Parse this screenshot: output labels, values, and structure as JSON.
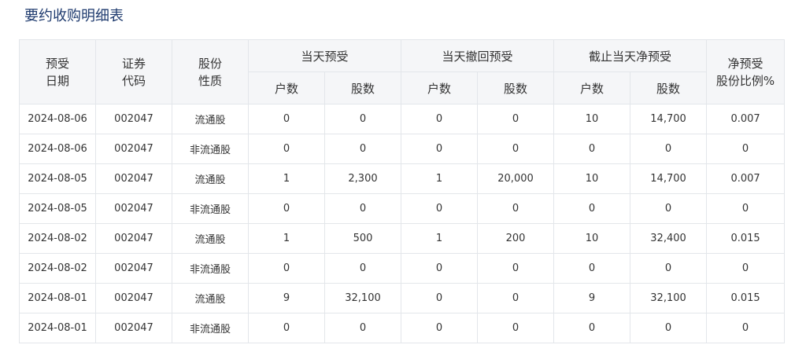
{
  "page": {
    "title": "要约收购明细表"
  },
  "table": {
    "headers": {
      "date_line1": "预受",
      "date_line2": "日期",
      "code_line1": "证券",
      "code_line2": "代码",
      "nature_line1": "股份",
      "nature_line2": "性质",
      "group_today": "当天预受",
      "group_withdraw": "当天撤回预受",
      "group_net": "截止当天净预受",
      "ratio_line1": "净预受",
      "ratio_line2": "股份比例%",
      "households": "户数",
      "shares": "股数"
    },
    "rows": [
      [
        "2024-08-06",
        "002047",
        "流通股",
        "0",
        "0",
        "0",
        "0",
        "10",
        "14,700",
        "0.007"
      ],
      [
        "2024-08-06",
        "002047",
        "非流通股",
        "0",
        "0",
        "0",
        "0",
        "0",
        "0",
        "0"
      ],
      [
        "2024-08-05",
        "002047",
        "流通股",
        "1",
        "2,300",
        "1",
        "20,000",
        "10",
        "14,700",
        "0.007"
      ],
      [
        "2024-08-05",
        "002047",
        "非流通股",
        "0",
        "0",
        "0",
        "0",
        "0",
        "0",
        "0"
      ],
      [
        "2024-08-02",
        "002047",
        "流通股",
        "1",
        "500",
        "1",
        "200",
        "10",
        "32,400",
        "0.015"
      ],
      [
        "2024-08-02",
        "002047",
        "非流通股",
        "0",
        "0",
        "0",
        "0",
        "0",
        "0",
        "0"
      ],
      [
        "2024-08-01",
        "002047",
        "流通股",
        "9",
        "32,100",
        "0",
        "0",
        "9",
        "32,100",
        "0.015"
      ],
      [
        "2024-08-01",
        "002047",
        "非流通股",
        "0",
        "0",
        "0",
        "0",
        "0",
        "0",
        "0"
      ]
    ]
  }
}
